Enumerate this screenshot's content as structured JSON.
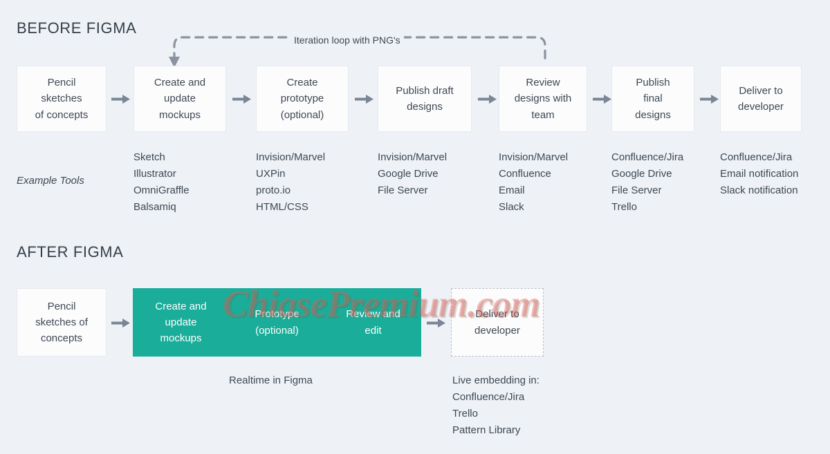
{
  "sections": {
    "before": {
      "title": "BEFORE FIGMA",
      "loop_label": "Iteration loop with PNG's",
      "tools_label": "Example Tools",
      "steps": [
        {
          "lines": [
            "Pencil",
            "sketches",
            "of concepts"
          ],
          "tools": []
        },
        {
          "lines": [
            "Create and",
            "update",
            "mockups"
          ],
          "tools": [
            "Sketch",
            "Illustrator",
            "OmniGraffle",
            "Balsamiq"
          ]
        },
        {
          "lines": [
            "Create",
            "prototype",
            "(optional)"
          ],
          "tools": [
            "Invision/Marvel",
            "UXPin",
            "proto.io",
            "HTML/CSS"
          ]
        },
        {
          "lines": [
            "Publish draft",
            "designs"
          ],
          "tools": [
            "Invision/Marvel",
            "Google Drive",
            "File Server"
          ]
        },
        {
          "lines": [
            "Review",
            "designs with",
            "team"
          ],
          "tools": [
            "Invision/Marvel",
            "Confluence",
            "Email",
            "Slack"
          ]
        },
        {
          "lines": [
            "Publish",
            "final",
            "designs"
          ],
          "tools": [
            "Confluence/Jira",
            "Google Drive",
            "File Server",
            "Trello"
          ]
        },
        {
          "lines": [
            "Deliver to",
            "developer"
          ],
          "tools": [
            "Confluence/Jira",
            "Email notification",
            "Slack notification"
          ]
        }
      ]
    },
    "after": {
      "title": "AFTER FIGMA",
      "first_box": {
        "lines": [
          "Pencil",
          "sketches of",
          "concepts"
        ]
      },
      "figma_cells": [
        {
          "lines": [
            "Create and",
            "update",
            "mockups"
          ]
        },
        {
          "lines": [
            "Prototype",
            "(optional)"
          ]
        },
        {
          "lines": [
            "Review and",
            "edit"
          ]
        }
      ],
      "last_box": {
        "lines": [
          "Deliver to",
          "developer"
        ]
      },
      "figma_caption": [
        "Realtime in Figma"
      ],
      "deliver_caption": [
        "Live embedding in:",
        "Confluence/Jira",
        "Trello",
        "Pattern Library"
      ]
    }
  },
  "watermark": {
    "text": "ChiasePremium.com"
  },
  "colors": {
    "background": "#eef1f6",
    "box_fill": "#fcfcfd",
    "figma_green": "#19ad9a",
    "text": "#3d4852",
    "arrow": "#7a8695",
    "dashed_border": "#b9c0ca",
    "watermark": "#e85a55"
  }
}
